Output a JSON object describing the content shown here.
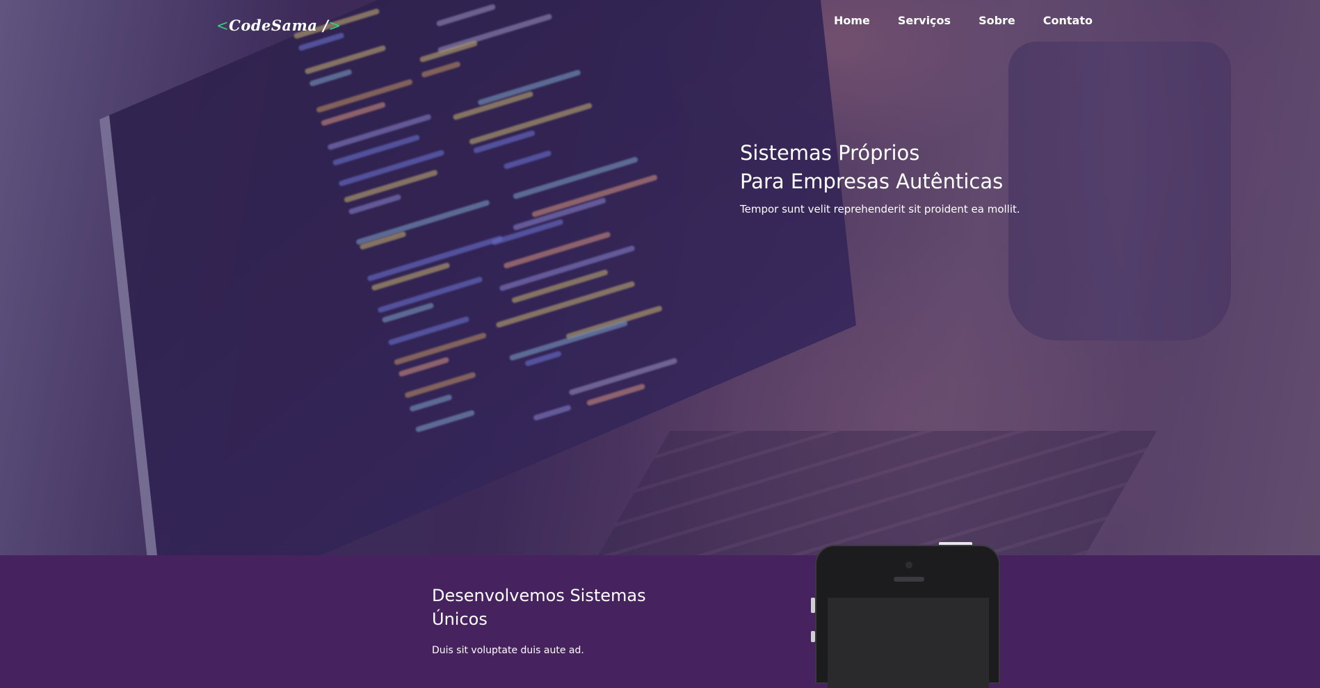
{
  "header": {
    "logo": {
      "open_bracket": "<",
      "name": "CodeSama",
      "slash": " /",
      "close_bracket": ">"
    },
    "nav": [
      {
        "label": "Home"
      },
      {
        "label": "Serviços"
      },
      {
        "label": "Sobre"
      },
      {
        "label": "Contato"
      }
    ]
  },
  "hero": {
    "title_line1": "Sistemas Próprios",
    "title_line2": "Para Empresas Autênticas",
    "subtitle": "Tempor sunt velit reprehenderit sit proident ea mollit."
  },
  "section": {
    "heading": "Desenvolvemos Sistemas Únicos",
    "text": "Duis sit voluptate duis aute ad."
  },
  "colors": {
    "primary": "#46225f",
    "accent": "#35d07f",
    "text": "#ffffff"
  },
  "icons": {
    "phone": "smartphone-mockup"
  }
}
